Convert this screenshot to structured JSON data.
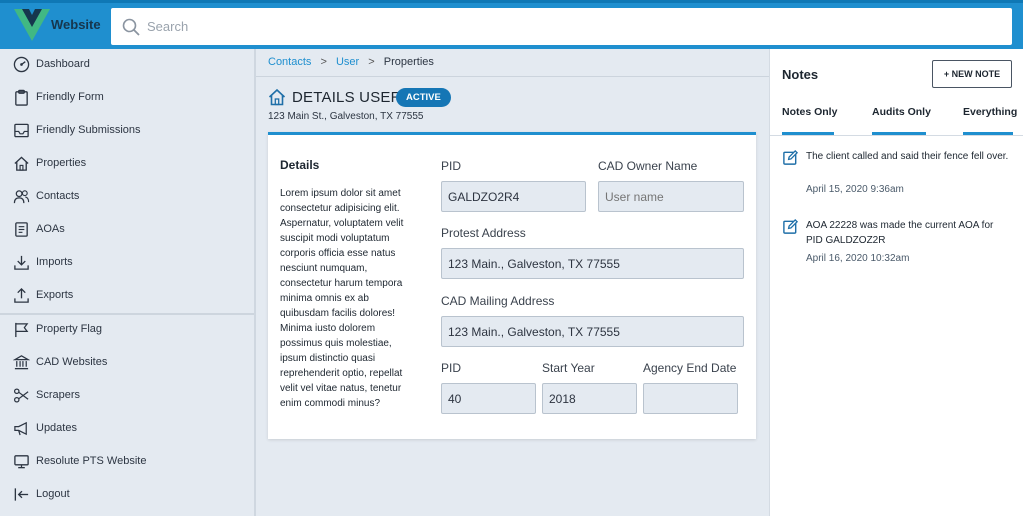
{
  "app": {
    "brand": "Website"
  },
  "search": {
    "placeholder": "Search"
  },
  "sidebar": {
    "items": [
      {
        "label": "Dashboard",
        "icon": "dashboard-icon"
      },
      {
        "label": "Friendly Form",
        "icon": "clipboard-icon"
      },
      {
        "label": "Friendly Submissions",
        "icon": "inbox-icon"
      },
      {
        "label": "Properties",
        "icon": "home-icon"
      },
      {
        "label": "Contacts",
        "icon": "people-icon"
      },
      {
        "label": "AOAs",
        "icon": "document-icon"
      },
      {
        "label": "Imports",
        "icon": "download-icon"
      },
      {
        "label": "Exports",
        "icon": "upload-icon"
      },
      {
        "label": "Property Flag",
        "icon": "flag-icon"
      },
      {
        "label": "CAD Websites",
        "icon": "bank-icon"
      },
      {
        "label": "Scrapers",
        "icon": "scissors-icon"
      },
      {
        "label": "Updates",
        "icon": "megaphone-icon"
      },
      {
        "label": "Resolute PTS Website",
        "icon": "monitor-icon"
      },
      {
        "label": "Logout",
        "icon": "logout-icon"
      }
    ]
  },
  "breadcrumb": {
    "contacts": "Contacts",
    "user": "User",
    "current": "Properties",
    "sep": ">"
  },
  "header": {
    "title": "DETAILS USER",
    "badge": "ACTIVE",
    "address": "123 Main St., Galveston, TX 77555"
  },
  "details": {
    "title": "Details",
    "description": "Lorem ipsum dolor sit amet consectetur adipisicing elit. Aspernatur, voluptatem velit suscipit modi voluptatum corporis officia esse natus nesciunt numquam, consectetur harum tempora minima omnis ex ab quibusdam facilis dolores! Minima iusto dolorem possimus quis molestiae, ipsum distinctio quasi reprehenderit optio, repellat velit vel vitae natus, tenetur enim commodi minus?",
    "fields": {
      "pid_label": "PID",
      "pid_value": "GALDZO2R4",
      "owner_label": "CAD Owner Name",
      "owner_placeholder": "User name",
      "protest_label": "Protest Address",
      "protest_value": "123 Main., Galveston, TX 77555",
      "mailing_label": "CAD Mailing Address",
      "mailing_value": "123 Main., Galveston, TX 77555",
      "pid2_label": "PID",
      "pid2_value": "40",
      "start_label": "Start Year",
      "start_value": "2018",
      "end_label": "Agency End Date",
      "end_value": ""
    }
  },
  "notes": {
    "title": "Notes",
    "new_button": "+ NEW NOTE",
    "tabs": [
      "Notes Only",
      "Audits Only",
      "Everything"
    ],
    "items": [
      {
        "text": "The client called and said their fence fell over.",
        "time": "April 15, 2020 9:36am"
      },
      {
        "text": "AOA 22228 was made the current AOA for PID GALDZOZ2R",
        "time": "April 16, 2020 10:32am"
      }
    ]
  },
  "colors": {
    "accent": "#1f8fcf",
    "badge": "#1576b5",
    "sidebar_bg": "#e4eaf1"
  }
}
